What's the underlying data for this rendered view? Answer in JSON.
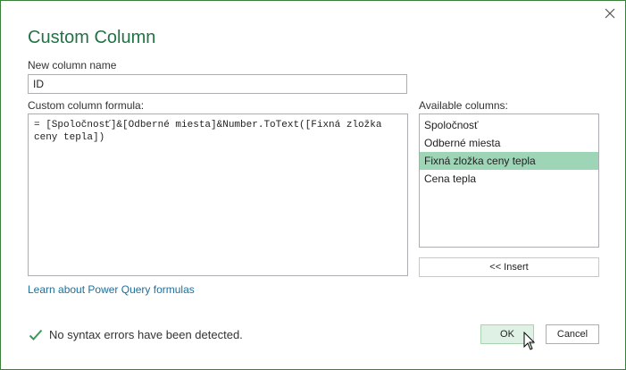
{
  "dialog": {
    "title": "Custom Column",
    "close_icon": "close-icon"
  },
  "name_field": {
    "label": "New column name",
    "value": "ID"
  },
  "formula_field": {
    "label": "Custom column formula:",
    "value": "= [Spoločnosť]&[Odberné miesta]&Number.ToText([Fixná zložka ceny tepla])"
  },
  "available_columns": {
    "label": "Available columns:",
    "items": [
      {
        "label": "Spoločnosť",
        "selected": false
      },
      {
        "label": "Odberné miesta",
        "selected": false
      },
      {
        "label": "Fixná zložka ceny tepla",
        "selected": true
      },
      {
        "label": "Cena tepla",
        "selected": false
      }
    ],
    "insert_label": "<< Insert"
  },
  "learn_link": "Learn about Power Query formulas",
  "status": {
    "icon": "checkmark-icon",
    "text": "No syntax errors have been detected.",
    "color": "#3a9a5a"
  },
  "buttons": {
    "ok_label": "OK",
    "cancel_label": "Cancel"
  },
  "colors": {
    "title": "#217346",
    "selected_item": "#9fd5b7",
    "link": "#1f6f9a",
    "ok_bg": "#dff1e4"
  }
}
